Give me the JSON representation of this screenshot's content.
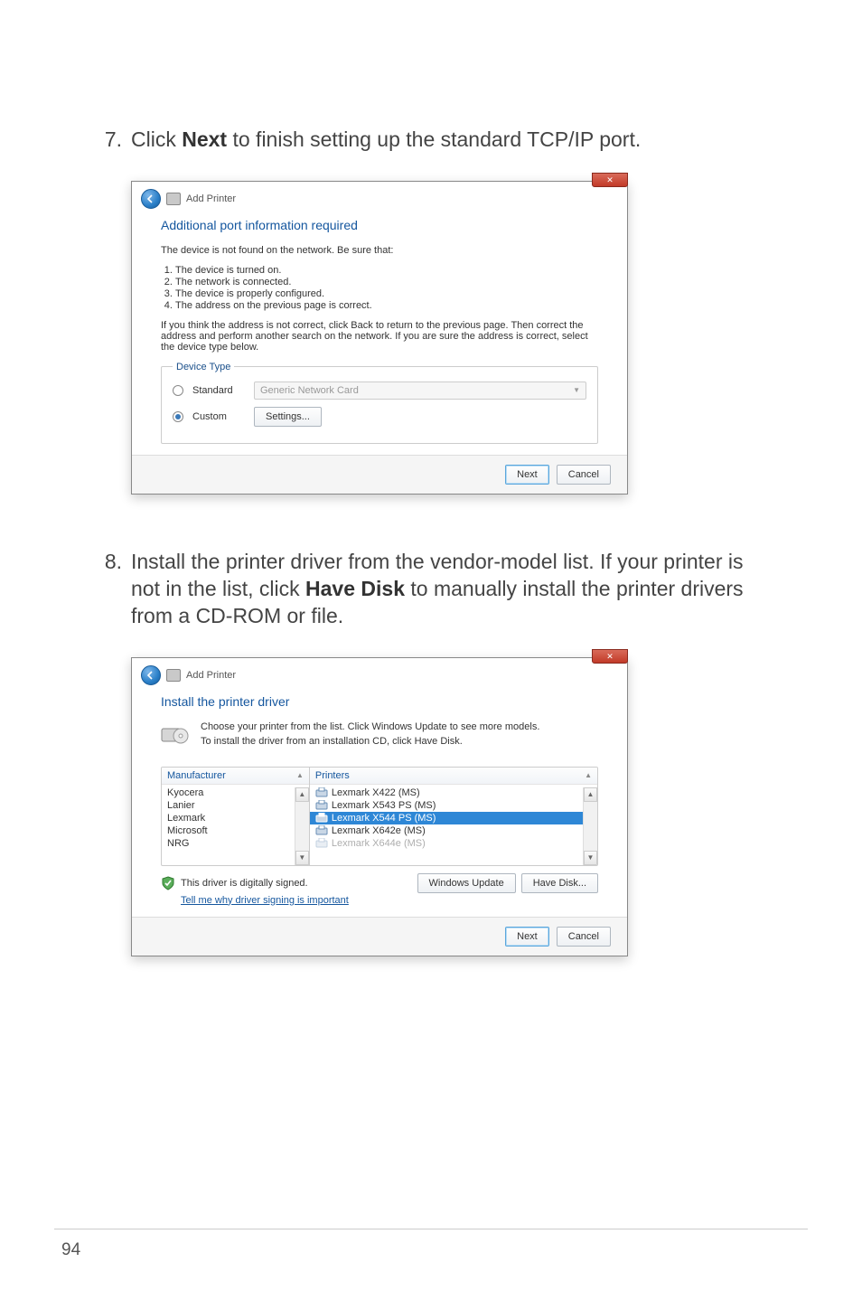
{
  "pageNumber": "94",
  "step7": {
    "number": "7.",
    "text_before": "Click ",
    "bold": "Next",
    "text_after": " to finish setting up the standard TCP/IP port."
  },
  "step8": {
    "number": "8.",
    "text_before": "Install the printer driver from the vendor-model list. If your printer is not in the list, click ",
    "bold": "Have Disk",
    "text_after": " to manually install the printer drivers from a CD-ROM or file."
  },
  "dialog1": {
    "close": "✕",
    "title": "Add Printer",
    "heading": "Additional port information required",
    "line1": "The device is not found on the network.  Be sure that:",
    "list": [
      "The device is turned on.",
      "The network is connected.",
      "The device is properly configured.",
      "The address on the previous page is correct."
    ],
    "para": "If you think the address is not correct, click Back to return to the previous page.  Then correct the address and perform another search on the network.  If you are sure the address is correct, select the device type below.",
    "fieldsetLegend": "Device Type",
    "radioStandard": "Standard",
    "comboValue": "Generic Network Card",
    "radioCustom": "Custom",
    "settingsBtn": "Settings...",
    "nextBtn": "Next",
    "cancelBtn": "Cancel"
  },
  "dialog2": {
    "close": "✕",
    "title": "Add Printer",
    "heading": "Install the printer driver",
    "line1": "Choose your printer from the list. Click Windows Update to see more models.",
    "line2": "To install the driver from an installation CD, click Have Disk.",
    "manufHeader": "Manufacturer",
    "printersHeader": "Printers",
    "manufacturers": [
      "Kyocera",
      "Lanier",
      "Lexmark",
      "Microsoft",
      "NRG"
    ],
    "printers": [
      {
        "label": "Lexmark X422 (MS)",
        "sel": false
      },
      {
        "label": "Lexmark X543 PS (MS)",
        "sel": false
      },
      {
        "label": "Lexmark X544 PS (MS)",
        "sel": true
      },
      {
        "label": "Lexmark X642e (MS)",
        "sel": false
      },
      {
        "label": "Lexmark X644e (MS)",
        "sel": false
      }
    ],
    "signedText": "This driver is digitally signed.",
    "whyLink": "Tell me why driver signing is important",
    "updateBtn": "Windows Update",
    "haveDiskBtn": "Have Disk...",
    "nextBtn": "Next",
    "cancelBtn": "Cancel"
  }
}
